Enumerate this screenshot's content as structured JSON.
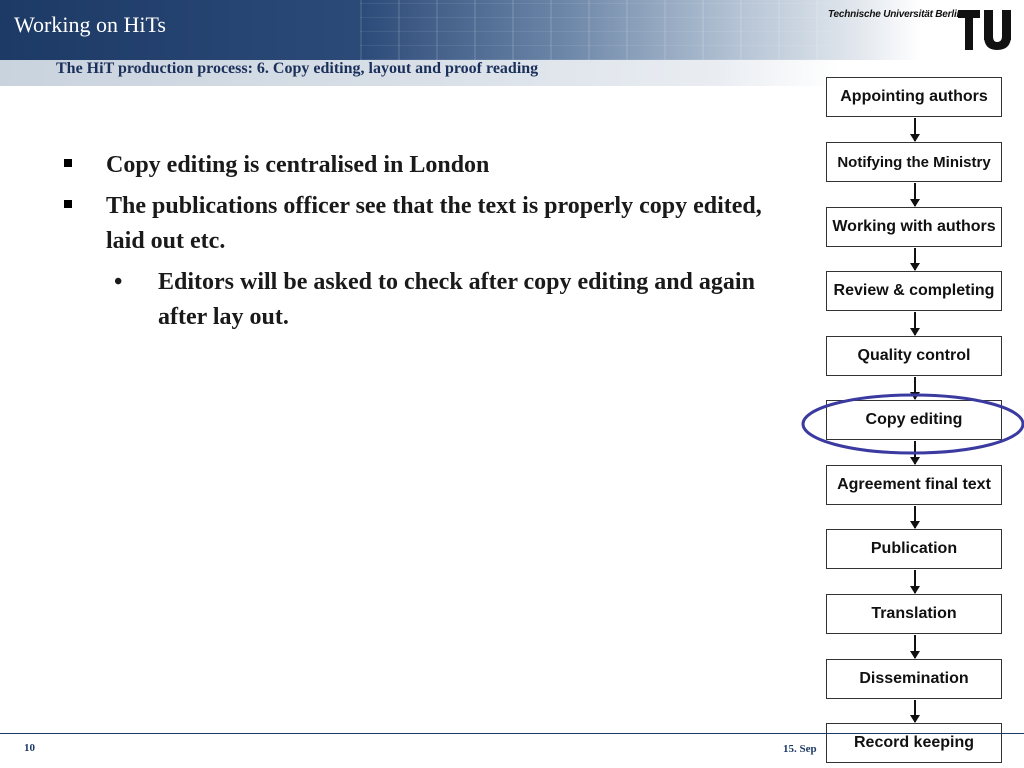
{
  "header": {
    "title": "Working on HiTs",
    "subtitle": "The HiT production process: 6. Copy editing, layout and proof reading",
    "university": "Technische Universität Berlin",
    "logo_icon": "tu-berlin-logo-icon"
  },
  "content": {
    "bullets": [
      "Copy editing is centralised in London",
      "The publications officer see that the text is properly copy edited, laid out etc."
    ],
    "sub_bullet": "Editors will be asked to check after copy editing and again after lay out."
  },
  "flow": {
    "steps": [
      "Appointing authors",
      "Notifying the Ministry",
      "Working with authors",
      "Review & completing",
      "Quality control",
      "Copy editing",
      "Agreement final text",
      "Publication",
      "Translation",
      "Dissemination",
      "Record keeping"
    ],
    "highlighted_step": "Copy editing",
    "highlight_color": "#3a3aa0"
  },
  "footer": {
    "page_number": "10",
    "date": "15. Sep"
  },
  "colors": {
    "header_blue": "#1d3a66",
    "subtitle_color": "#1a2f5a"
  }
}
